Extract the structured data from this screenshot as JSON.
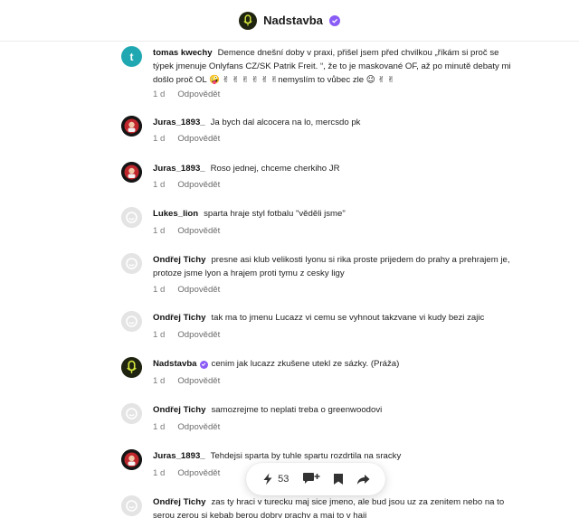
{
  "header": {
    "title": "Nadstavba",
    "verified_icon": "verified-badge-icon",
    "accent": "#8a5cf6"
  },
  "comments": [
    {
      "author": "tomas kwechy",
      "avatar": "letter-t",
      "avatar_letter": "t",
      "text": "Demence dnešní doby v praxi, přišel jsem před chvilkou „říkám si proč se týpek jmenuje Onlyfans CZ/SK Patrik Freit. “, že to je maskované OF, až po minutě debaty mi došlo proč OL 🤪 ✌ ✌ ✌ ✌ ✌ ✌nemyslím to vůbec zle 😉 ✌ ✌",
      "time": "1 d",
      "reply": "Odpovědět"
    },
    {
      "author": "Juras_1893_",
      "avatar": "juras-photo",
      "text": "Ja bych dal alcocera na lo, mercsdo pk",
      "time": "1 d",
      "reply": "Odpovědět"
    },
    {
      "author": "Juras_1893_",
      "avatar": "juras-photo",
      "text": "Roso jednej, chceme cherkiho JR",
      "time": "1 d",
      "reply": "Odpovědět"
    },
    {
      "author": "Lukes_lion",
      "avatar": "default-avatar",
      "text": "sparta hraje styl fotbalu \"věděli jsme\"",
      "time": "1 d",
      "reply": "Odpovědět"
    },
    {
      "author": "Ondřej Tichy",
      "avatar": "default-avatar",
      "text": "presne asi klub velikosti lyonu si rika proste prijedem do prahy a prehrajem je, protoze jsme lyon a hrajem proti tymu z cesky ligy",
      "time": "1 d",
      "reply": "Odpovědět"
    },
    {
      "author": "Ondřej Tichy",
      "avatar": "default-avatar",
      "text": "tak ma to jmenu Lucazz vi cemu se vyhnout takzvane vi kudy bezi zajic",
      "time": "1 d",
      "reply": "Odpovědět"
    },
    {
      "author": "Nadstavba",
      "avatar": "nadstavba-logo",
      "verified": true,
      "text": "cenim jak lucazz zkušene utekl ze sázky. (Práža)",
      "time": "1 d",
      "reply": "Odpovědět"
    },
    {
      "author": "Ondřej Tichy",
      "avatar": "default-avatar",
      "text": "samozrejme to neplati treba o greenwoodovi",
      "time": "1 d",
      "reply": "Odpovědět"
    },
    {
      "author": "Juras_1893_",
      "avatar": "juras-photo",
      "text": "Tehdejsi sparta by tuhle spartu rozdrtila na sracky",
      "time": "1 d",
      "reply": "Odpovědět"
    },
    {
      "author": "Ondřej Tichy",
      "avatar": "default-avatar",
      "text": "zas ty hraci v turecku maj sice jmeno, ale bud jsou uz za zenitem nebo na to serou zerou si kebab berou dobry prachy a maj to v haji",
      "time": "",
      "reply": ""
    }
  ],
  "toolbar": {
    "like_icon": "lightning-like-icon",
    "like_count": "53",
    "comment_icon": "add-comment-icon",
    "bookmark_icon": "bookmark-icon",
    "share_icon": "share-arrow-icon"
  }
}
